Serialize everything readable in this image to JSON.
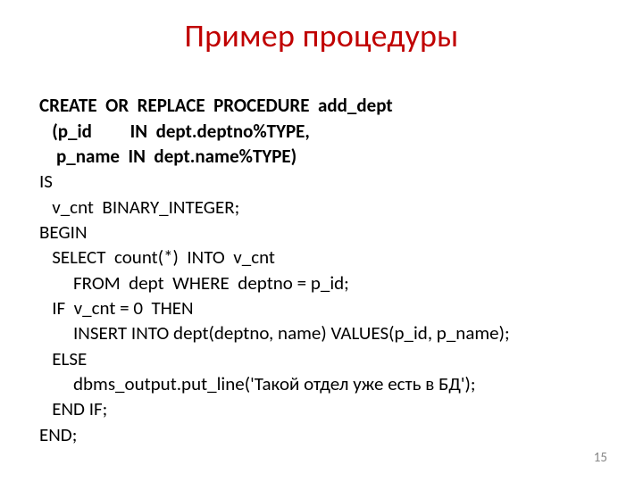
{
  "title": "Пример процедуры",
  "code": {
    "l1": "CREATE  OR  REPLACE  PROCEDURE  add_dept",
    "l2": "   (p_id         IN  dept.deptno%TYPE,",
    "l3": "    p_name  IN  dept.name%TYPE)",
    "l4": "IS",
    "l5": "   v_cnt  BINARY_INTEGER;",
    "l6": "BEGIN",
    "l7": "   SELECT  count(*)  INTO  v_cnt",
    "l8": "        FROM  dept  WHERE  deptno = p_id;",
    "l9": "   IF  v_cnt = 0  THEN",
    "l10": "        INSERT INTO dept(deptno, name) VALUES(p_id, p_name);",
    "l11": "   ELSE",
    "l12": "        dbms_output.put_line('Такой отдел уже есть в БД');",
    "l13": "   END IF;",
    "l14": "END;"
  },
  "page_number": "15"
}
